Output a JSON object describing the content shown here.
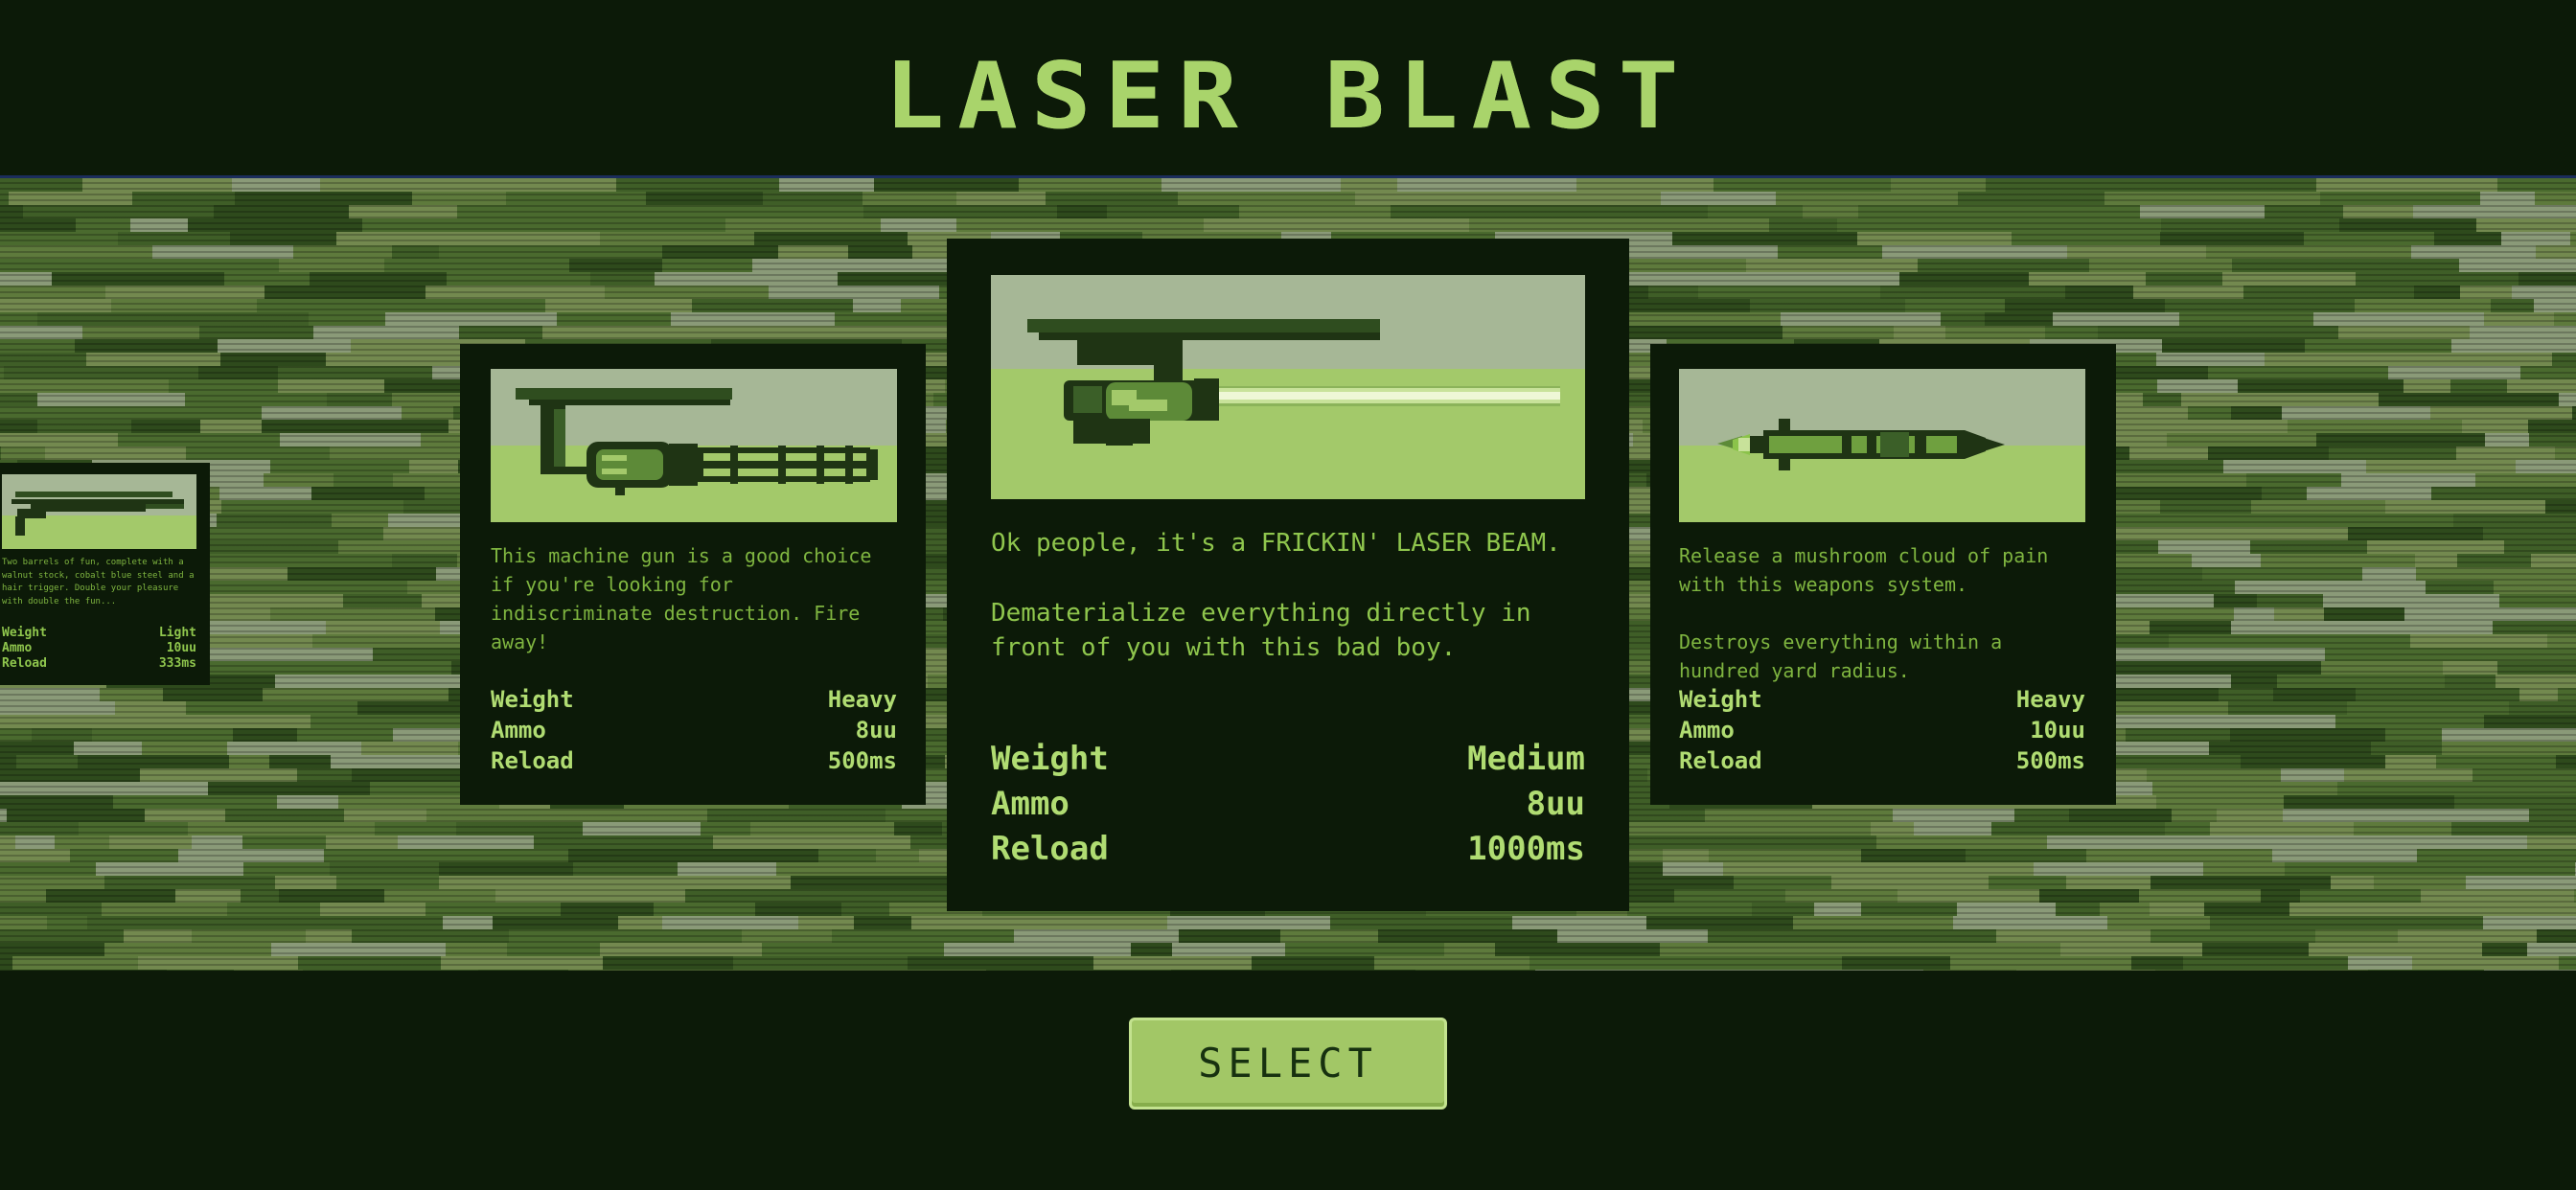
{
  "game": {
    "title": "LASER BLAST"
  },
  "carousel": {
    "weapons": [
      {
        "id": "pistol",
        "description": [
          "Two barrels of fun, complete with a walnut stock, cobalt blue steel and a hair trigger. Double your pleasure with double the fun..."
        ],
        "stats": [
          {
            "label": "Weight",
            "value": "Light"
          },
          {
            "label": "Ammo",
            "value": "10uu"
          },
          {
            "label": "Reload",
            "value": "333ms"
          }
        ]
      },
      {
        "id": "machine-gun",
        "description": [
          "This machine gun is a good choice if you're looking for indiscriminate destruction. Fire away!"
        ],
        "stats": [
          {
            "label": "Weight",
            "value": "Heavy"
          },
          {
            "label": "Ammo",
            "value": "8uu"
          },
          {
            "label": "Reload",
            "value": "500ms"
          }
        ]
      },
      {
        "id": "laser-beam",
        "selected": true,
        "description": [
          "Ok people, it's a FRICKIN' LASER BEAM.",
          "Dematerialize everything directly in front of you with this bad boy."
        ],
        "stats": [
          {
            "label": "Weight",
            "value": "Medium"
          },
          {
            "label": "Ammo",
            "value": "8uu"
          },
          {
            "label": "Reload",
            "value": "1000ms"
          }
        ]
      },
      {
        "id": "rocket",
        "description": [
          "Release a mushroom cloud of pain with this weapons system.",
          "Destroys everything within a hundred yard radius."
        ],
        "stats": [
          {
            "label": "Weight",
            "value": "Heavy"
          },
          {
            "label": "Ammo",
            "value": "10uu"
          },
          {
            "label": "Reload",
            "value": "500ms"
          }
        ]
      }
    ]
  },
  "actions": {
    "select_label": "SELECT"
  },
  "colors": {
    "background": "#0c1a08",
    "accent": "#a9d46b",
    "text": "#8fc64d",
    "camo_dark": "#2e4a1c",
    "camo_mid": "#5e7a3c",
    "camo_light": "#8a9a78"
  }
}
